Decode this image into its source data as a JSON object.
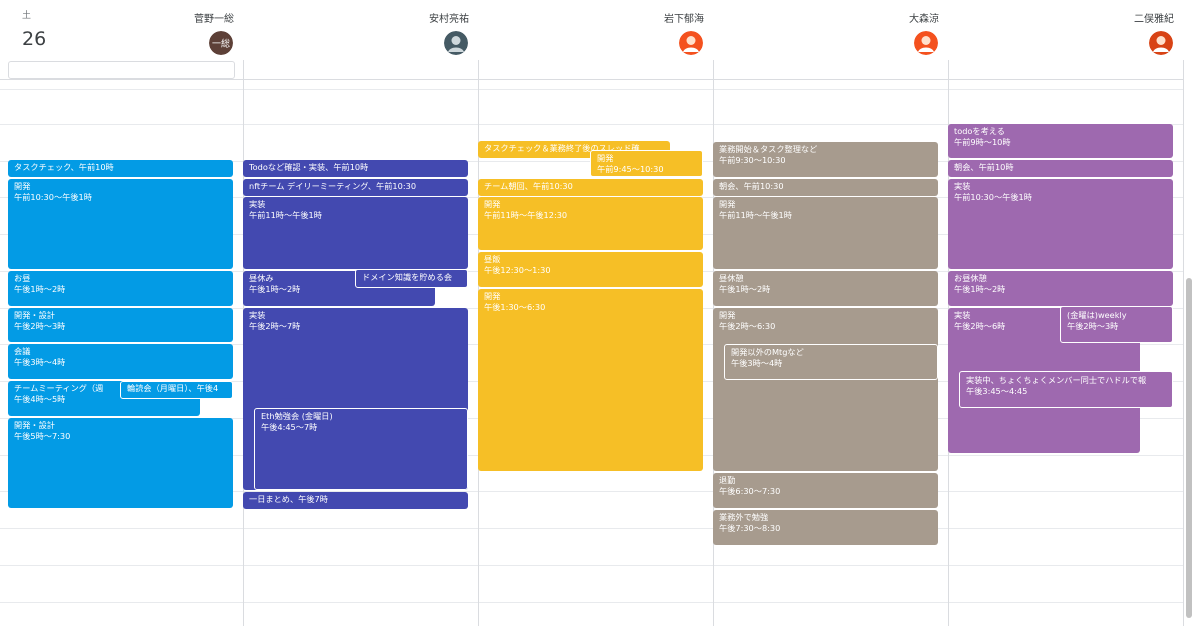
{
  "day": {
    "weekday": "土",
    "date": "26"
  },
  "colors": {
    "blue": "#039be5",
    "indigo": "#4349b0",
    "yellow": "#f6bf26",
    "grey": "#a79b8e",
    "purple": "#9e69af"
  },
  "people": [
    {
      "name": "菅野一総",
      "avatar_text": "一総",
      "avatar_color": "#5d4037"
    },
    {
      "name": "安村亮祐",
      "avatar_text": "",
      "avatar_color": "#455a64"
    },
    {
      "name": "岩下郁海",
      "avatar_text": "",
      "avatar_color": "#f4511e"
    },
    {
      "name": "大森涼",
      "avatar_text": "",
      "avatar_color": "#f4511e"
    },
    {
      "name": "二俣雅紀",
      "avatar_text": "",
      "avatar_color": "#d84315"
    }
  ],
  "events": {
    "c0": [
      {
        "t": "タスクチェック、午前10時",
        "s": ""
      },
      {
        "t": "開発",
        "s": "午前10:30～午後1時"
      },
      {
        "t": "お昼",
        "s": "午後1時～2時"
      },
      {
        "t": "開発・設計",
        "s": "午後2時～3時"
      },
      {
        "t": "会議",
        "s": "午後3時～4時"
      },
      {
        "t": "チームミーティング（週",
        "s": "午後4時～5時"
      },
      {
        "t": "輪読会（月曜日）、午後4",
        "s": ""
      },
      {
        "t": "開発・設計",
        "s": "午後5時～7:30"
      }
    ],
    "c1": [
      {
        "t": "Todoなど確認・実装、午前10時",
        "s": ""
      },
      {
        "t": "nftチーム デイリーミーティング、午前10:30",
        "s": ""
      },
      {
        "t": "実装",
        "s": "午前11時～午後1時"
      },
      {
        "t": "昼休み",
        "s": "午後1時～2時"
      },
      {
        "t": "ドメイン知識を貯める会",
        "s": ""
      },
      {
        "t": "実装",
        "s": "午後2時～7時"
      },
      {
        "t": "Eth勉強会 (金曜日)",
        "s": "午後4:45～7時"
      },
      {
        "t": "一日まとめ、午後7時",
        "s": ""
      }
    ],
    "c2": [
      {
        "t": "タスクチェック＆業務終了後のスレッド確",
        "s": ""
      },
      {
        "t": "開発",
        "s": "午前9:45～10:30"
      },
      {
        "t": "チーム朝回、午前10:30",
        "s": ""
      },
      {
        "t": "開発",
        "s": "午前11時～午後12:30"
      },
      {
        "t": "昼飯",
        "s": "午後12:30～1:30"
      },
      {
        "t": "開発",
        "s": "午後1:30～6:30"
      }
    ],
    "c3": [
      {
        "t": "業務開始＆タスク整理など",
        "s": "午前9:30～10:30"
      },
      {
        "t": "朝会、午前10:30",
        "s": ""
      },
      {
        "t": "開発",
        "s": "午前11時～午後1時"
      },
      {
        "t": "昼休憩",
        "s": "午後1時～2時"
      },
      {
        "t": "開発",
        "s": "午後2時～6:30"
      },
      {
        "t": "開発以外のMtgなど",
        "s": "午後3時～4時"
      },
      {
        "t": "退勤",
        "s": "午後6:30～7:30"
      },
      {
        "t": "業務外で勉強",
        "s": "午後7:30～8:30"
      }
    ],
    "c4": [
      {
        "t": "todoを考える",
        "s": "午前9時～10時"
      },
      {
        "t": "朝会、午前10時",
        "s": ""
      },
      {
        "t": "実装",
        "s": "午前10:30～午後1時"
      },
      {
        "t": "お昼休憩",
        "s": "午後1時～2時"
      },
      {
        "t": "実装",
        "s": "午後2時～6時"
      },
      {
        "t": "(金曜は)weekly",
        "s": "午後2時～3時"
      },
      {
        "t": "実装中、ちょくちょくメンバー同士でハドルで報",
        "s": "午後3:45～4:45"
      }
    ]
  }
}
